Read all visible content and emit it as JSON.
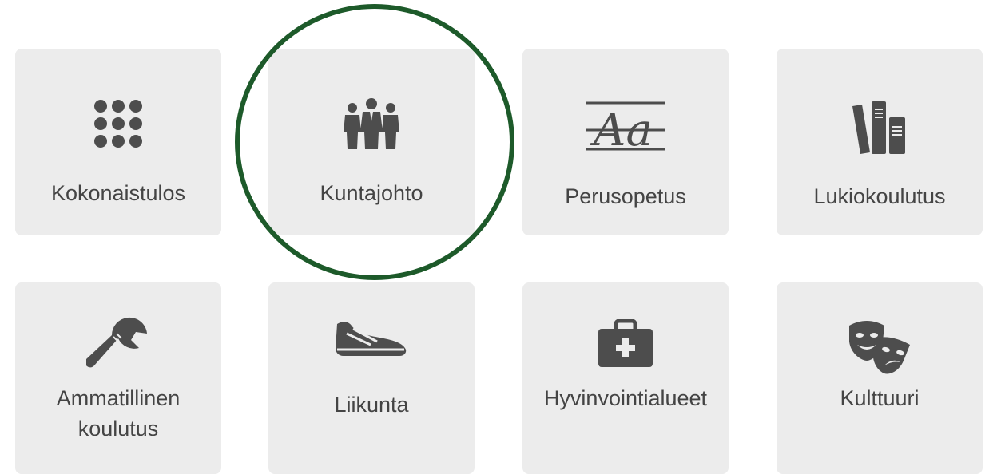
{
  "tiles": [
    {
      "label": "Kokonaistulos",
      "icon": "grid-dots-icon"
    },
    {
      "label": "Kuntajohto",
      "icon": "group-of-people-icon"
    },
    {
      "label": "Perusopetus",
      "icon": "letters-aa-icon"
    },
    {
      "label": "Lukiokoulutus",
      "icon": "books-icon"
    },
    {
      "label": "Ammatillinen\nkoulutus",
      "icon": "wrench-icon"
    },
    {
      "label": "Liikunta",
      "icon": "sneaker-icon"
    },
    {
      "label": "Hyvinvointialueet",
      "icon": "first-aid-kit-icon"
    },
    {
      "label": "Kulttuuri",
      "icon": "theater-masks-icon"
    }
  ],
  "highlight": {
    "color": "#1d5a2a"
  }
}
